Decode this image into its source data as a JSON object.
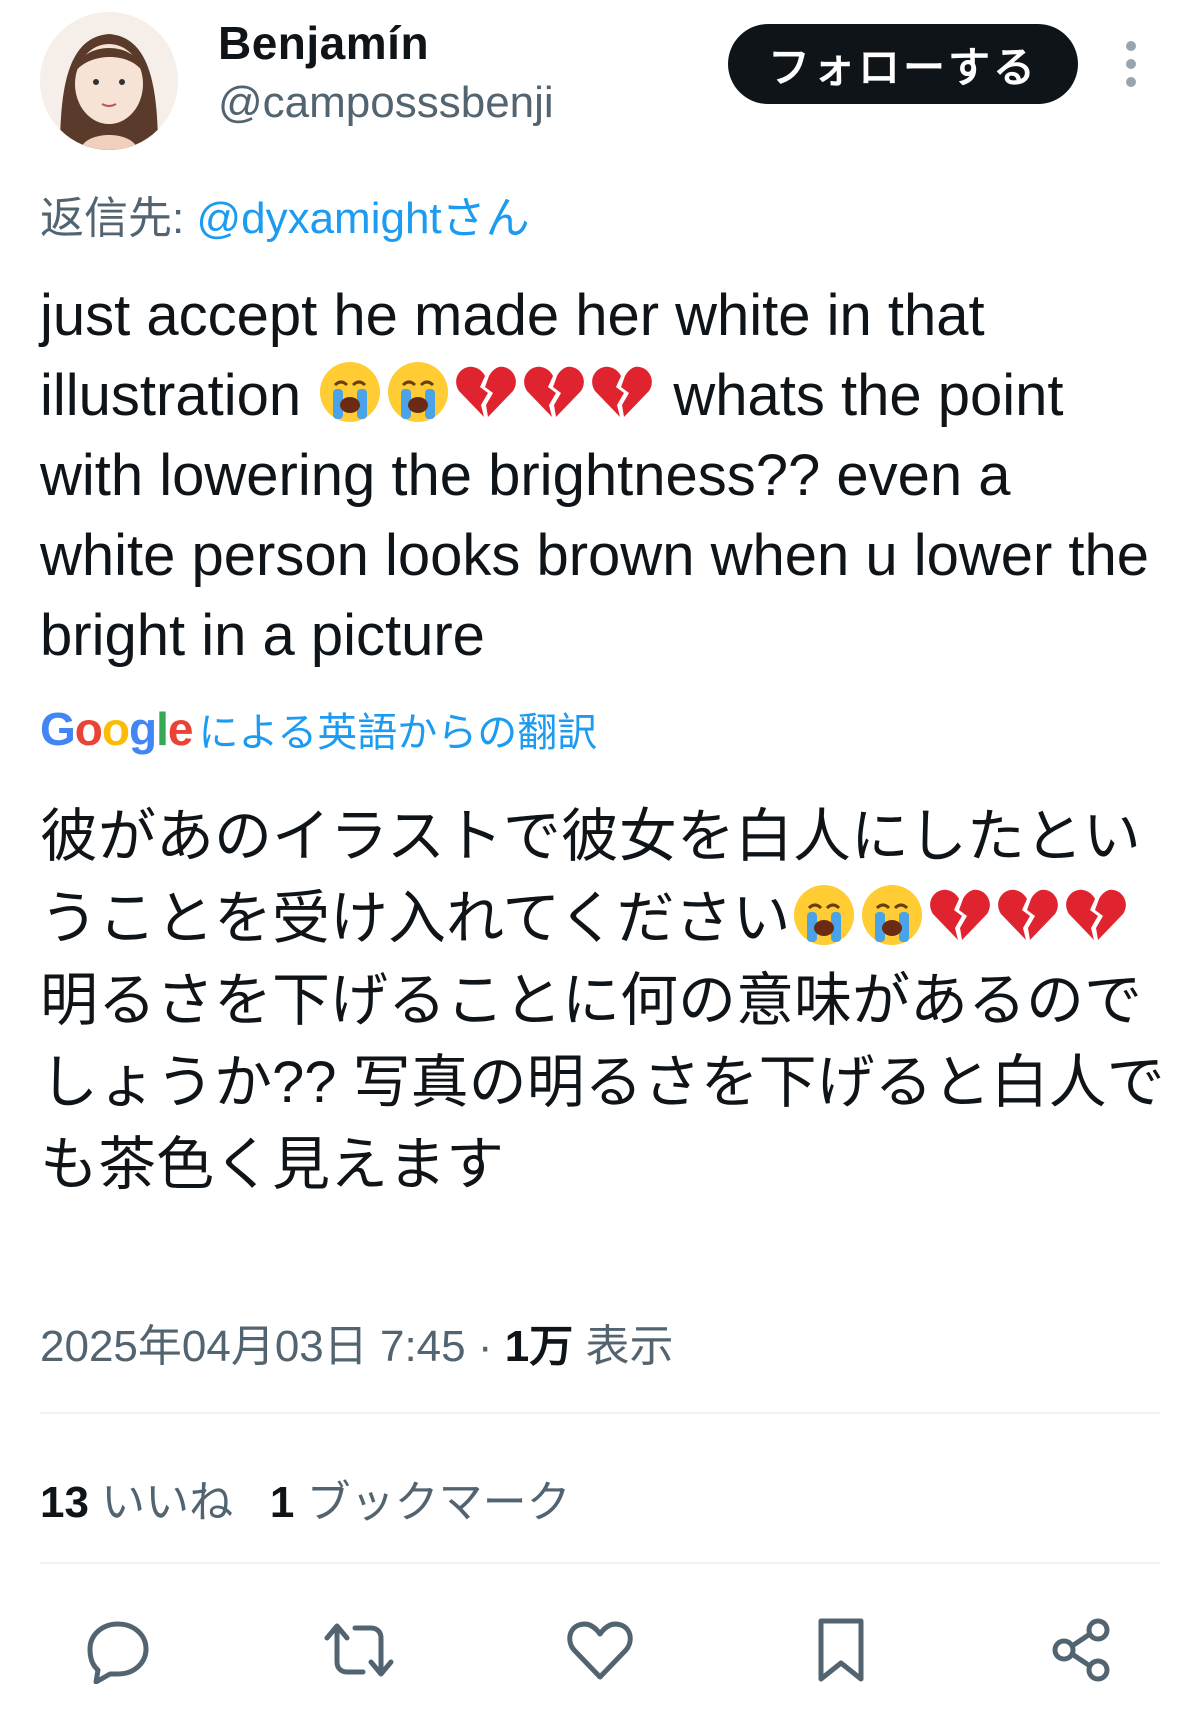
{
  "tweet": {
    "author_name": "Benjamín",
    "author_handle": "@camposssbenji",
    "follow_label": "フォローする",
    "reply_prefix": "返信先: ",
    "reply_mention": "@dyxamightさん",
    "text_part1": "just accept he made her white in that illustration ",
    "text_part2": " whats the point with lowering the brightness?? even a white person looks brown when u lower the bright in a picture",
    "translate_brand": "Google",
    "translate_label": "による英語からの翻訳",
    "translation_part1": "彼があのイラストで彼女を白人にしたということを受け入れてください",
    "translation_part2": "明るさを下げることに何の意味があるのでしょうか?? 写真の明るさを下げると白人でも茶色く見えます",
    "date": "2025年04月03日 7:45",
    "separator": " · ",
    "views_count": "1万",
    "views_label": " 表示",
    "likes_count": "13",
    "likes_label": " いいね",
    "bookmarks_count": "1",
    "bookmarks_label": " ブックマーク"
  },
  "emojis": [
    "loudly-crying-face",
    "loudly-crying-face",
    "broken-heart",
    "broken-heart",
    "broken-heart"
  ],
  "icons": {
    "actions": [
      "reply-icon",
      "repost-icon",
      "like-icon",
      "bookmark-icon",
      "share-icon"
    ]
  },
  "colors": {
    "link": "#1d9bf0",
    "secondary_text": "#536471",
    "primary_text": "#0f1419",
    "follow_bg": "#0f1419"
  }
}
